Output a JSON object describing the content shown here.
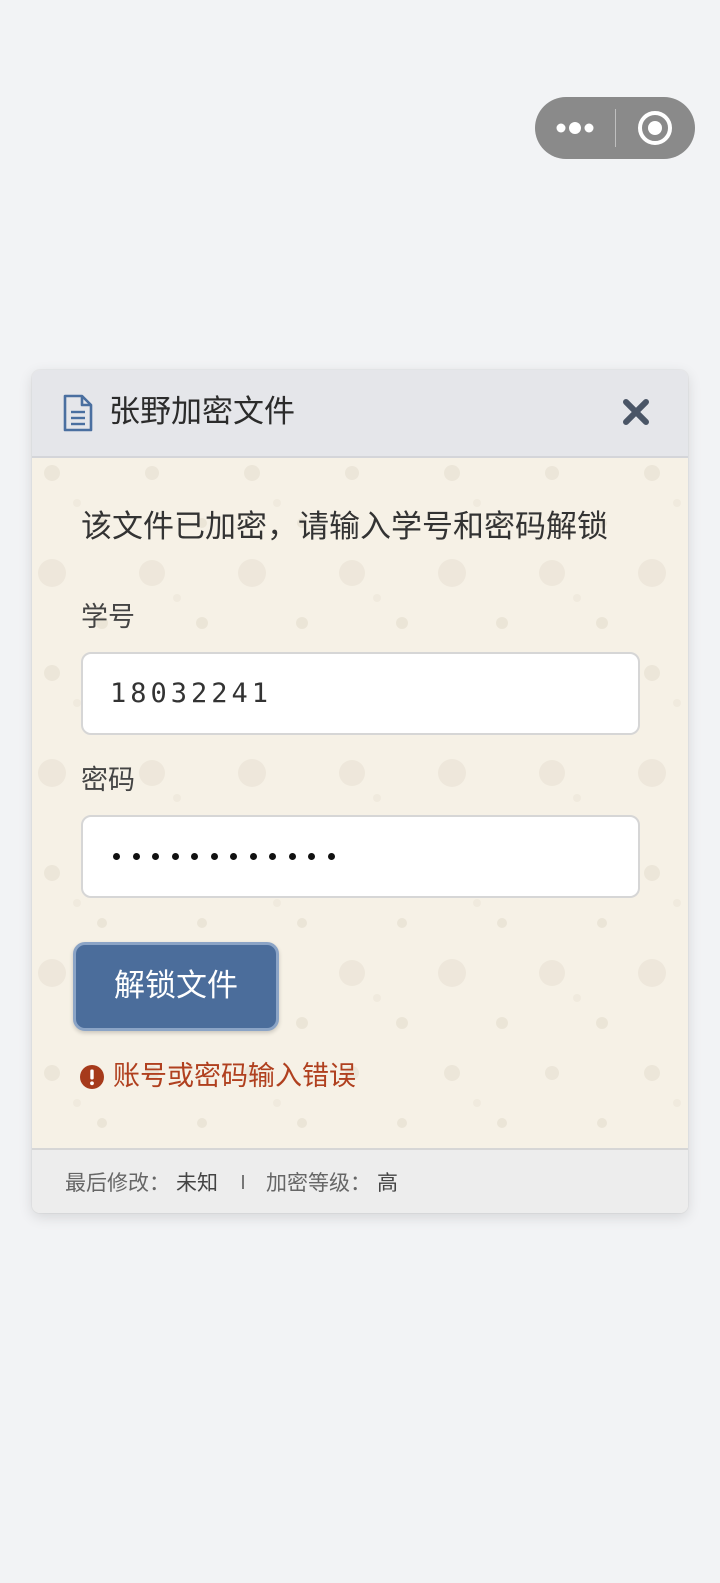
{
  "capsule": {
    "more_icon": "more-dots-icon",
    "close_icon": "target-circle-icon"
  },
  "dialog": {
    "title": "张野加密文件",
    "header_icon": "document-icon",
    "close_icon": "close-x-icon",
    "prompt": "该文件已加密，请输入学号和密码解锁",
    "student_id": {
      "label": "学号",
      "value": "18032241"
    },
    "password": {
      "label": "密码",
      "masked_length": 12
    },
    "unlock_button": "解锁文件",
    "error": {
      "icon": "exclamation-circle-icon",
      "text": "账号或密码输入错误"
    },
    "footer": {
      "modified_label": "最后修改：",
      "modified_value": "未知",
      "level_label": "加密等级：",
      "level_value": "高"
    }
  },
  "colors": {
    "page_bg": "#f2f3f5",
    "header_bg": "#e5e6ea",
    "body_bg": "#f6f1e6",
    "button_bg": "#4b6d9b",
    "error_red": "#b0401f",
    "icon_blue": "#4a6fa0"
  }
}
